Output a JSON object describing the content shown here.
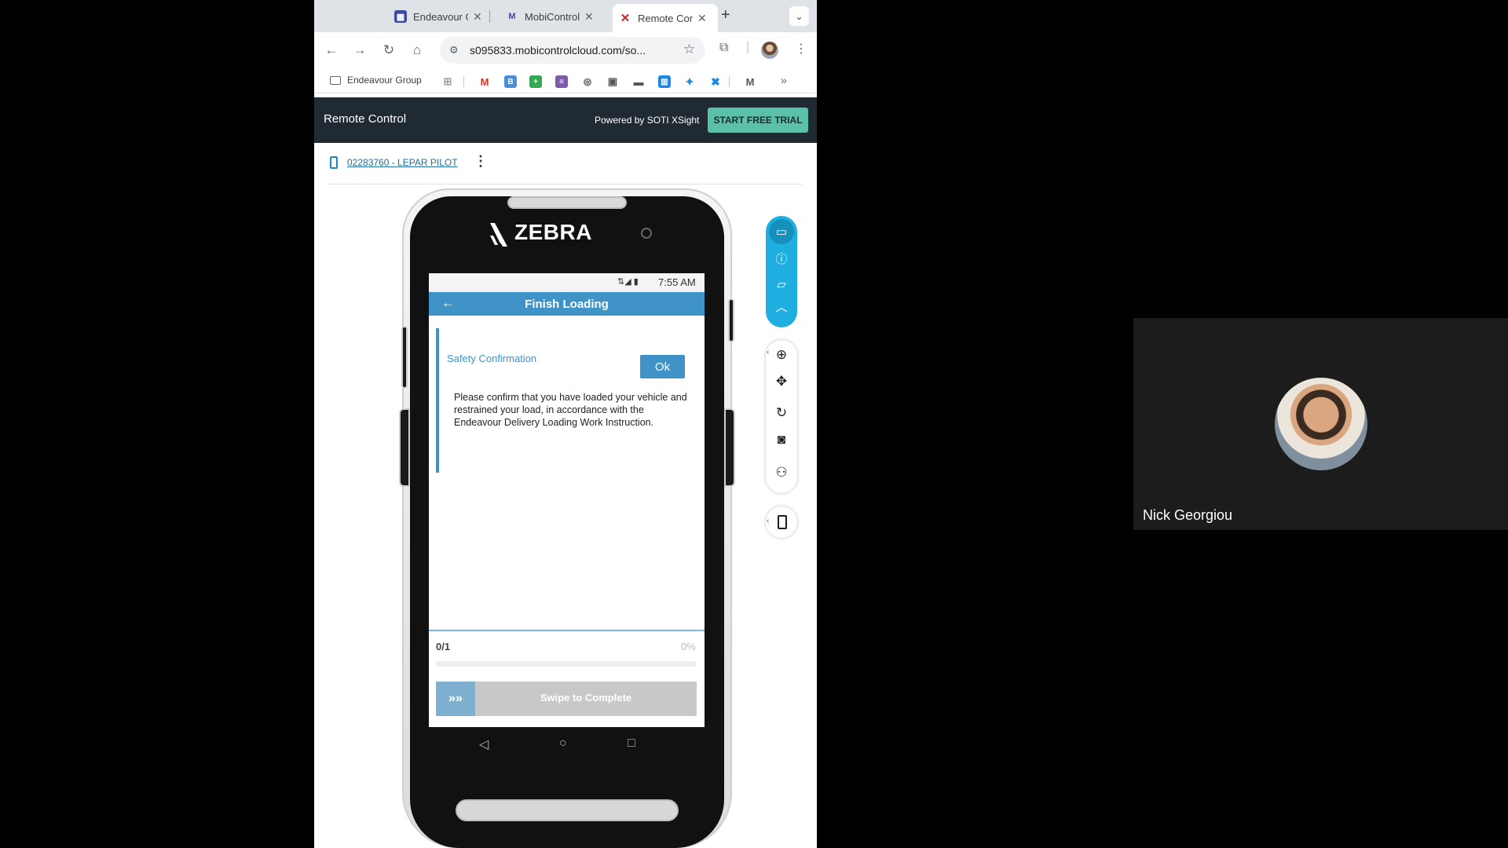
{
  "browser": {
    "tabs": [
      {
        "label": "Endeavour Group",
        "favicon": "calendar-icon",
        "active": false
      },
      {
        "label": "MobiControl",
        "favicon": "mobicontrol-icon",
        "active": false
      },
      {
        "label": "Remote Control",
        "favicon": "soti-icon",
        "active": true
      }
    ],
    "url": "s095833.mobicontrolcloud.com/so...",
    "bookmark_folder": "Endeavour Group"
  },
  "app": {
    "title": "Remote Control",
    "powered_by": "Powered by SOTI XSight",
    "trial_button": "START FREE TRIAL",
    "device_name": "02283760 - LEPAR PILOT"
  },
  "phone": {
    "brand": "ZEBRA",
    "status_time": "7:55 AM",
    "screen_title": "Finish Loading",
    "card_title": "Safety Confirmation",
    "ok_label": "Ok",
    "message": "Please confirm that you have loaded your vehicle and restrained your load, in accordance with the Endeavour Delivery Loading Work Instruction.",
    "progress_label": "0/1",
    "progress_pct": "0%",
    "progress_value": 0,
    "swipe_handle": "»»",
    "swipe_label": "Swipe to Complete"
  },
  "participant": {
    "name": "Nick Georgiou"
  },
  "colors": {
    "accent": "#3f93c7",
    "trial": "#5bc0a8",
    "header": "#1f2a33",
    "toolbar_pill": "#1eaee0"
  }
}
